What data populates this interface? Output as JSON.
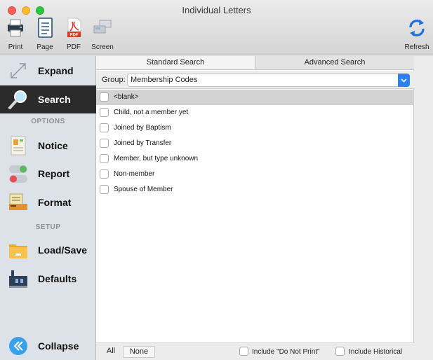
{
  "window": {
    "title": "Individual Letters"
  },
  "toolbar": {
    "print_label": "Print",
    "page_label": "Page",
    "pdf_label": "PDF",
    "screen_label": "Screen",
    "refresh_label": "Refresh",
    "pdf_badge": "PDF"
  },
  "sidebar": {
    "expand_label": "Expand",
    "search_label": "Search",
    "options_heading": "OPTIONS",
    "notice_label": "Notice",
    "report_label": "Report",
    "format_label": "Format",
    "setup_heading": "SETUP",
    "loadsave_label": "Load/Save",
    "defaults_label": "Defaults",
    "collapse_label": "Collapse"
  },
  "tabs": {
    "standard": "Standard Search",
    "advanced": "Advanced Search"
  },
  "group": {
    "label": "Group:",
    "value": "Membership Codes"
  },
  "list": [
    {
      "label": "<blank>",
      "checked": false
    },
    {
      "label": "Child, not a member yet",
      "checked": false
    },
    {
      "label": "Joined by Baptism",
      "checked": false
    },
    {
      "label": "Joined by Transfer",
      "checked": false
    },
    {
      "label": "Member, but type unknown",
      "checked": false
    },
    {
      "label": "Non-member",
      "checked": false
    },
    {
      "label": "Spouse of Member",
      "checked": false
    }
  ],
  "footer": {
    "all_label": "All",
    "none_label": "None",
    "include_dnp_label": "Include \"Do Not Print\"",
    "include_historical_label": "Include Historical"
  },
  "colors": {
    "accent": "#2e80f1",
    "selected_bg": "#2b2b2b",
    "sidebar_bg": "#dde1e8"
  }
}
